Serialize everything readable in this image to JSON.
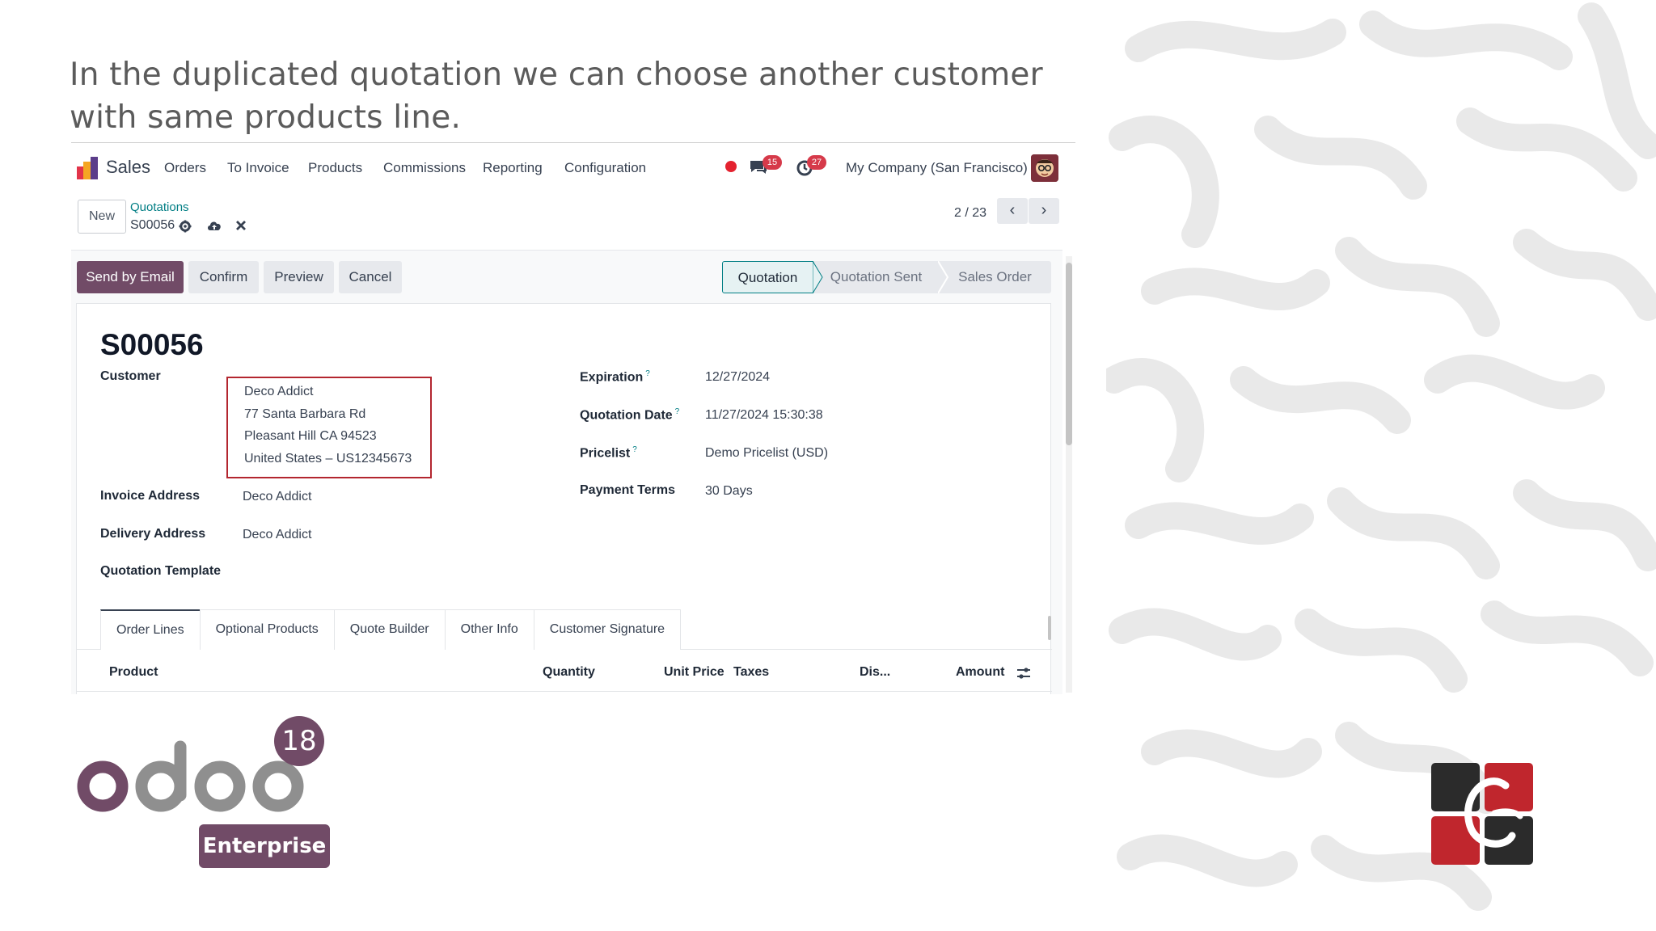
{
  "caption": "In the duplicated quotation we can choose another customer with same products line.",
  "navbar": {
    "app_name": "Sales",
    "menu": [
      "Orders",
      "To Invoice",
      "Products",
      "Commissions",
      "Reporting",
      "Configuration"
    ],
    "messages_count": "15",
    "activities_count": "27",
    "company": "My Company (San Francisco)"
  },
  "control_panel": {
    "new_label": "New",
    "breadcrumb": "Quotations",
    "record_name": "S00056",
    "pager": "2 / 23"
  },
  "actions": {
    "send_email": "Send by Email",
    "confirm": "Confirm",
    "preview": "Preview",
    "cancel": "Cancel"
  },
  "status": {
    "stages": [
      "Quotation",
      "Quotation Sent",
      "Sales Order"
    ],
    "current": "Quotation"
  },
  "form": {
    "title": "S00056",
    "customer_label": "Customer",
    "customer_lines": [
      "Deco Addict",
      "77 Santa Barbara Rd",
      "Pleasant Hill CA 94523",
      "United States – US12345673"
    ],
    "invoice_address_label": "Invoice Address",
    "invoice_address": "Deco Addict",
    "delivery_address_label": "Delivery Address",
    "delivery_address": "Deco Addict",
    "template_label": "Quotation Template",
    "expiration_label": "Expiration",
    "expiration": "12/27/2024",
    "quotation_date_label": "Quotation Date",
    "quotation_date": "11/27/2024 15:30:38",
    "pricelist_label": "Pricelist",
    "pricelist": "Demo Pricelist (USD)",
    "payment_terms_label": "Payment Terms",
    "payment_terms": "30 Days",
    "help_mark": "?"
  },
  "tabs": [
    "Order Lines",
    "Optional Products",
    "Quote Builder",
    "Other Info",
    "Customer Signature"
  ],
  "columns": {
    "product": "Product",
    "quantity": "Quantity",
    "unit_price": "Unit Price",
    "taxes": "Taxes",
    "discount": "Dis...",
    "amount": "Amount"
  },
  "logo": {
    "version": "18",
    "edition": "Enterprise"
  },
  "colors": {
    "primary": "#714b67",
    "teal": "#017e84",
    "highlight_box": "#b3262f",
    "badge": "#d63a4a"
  }
}
